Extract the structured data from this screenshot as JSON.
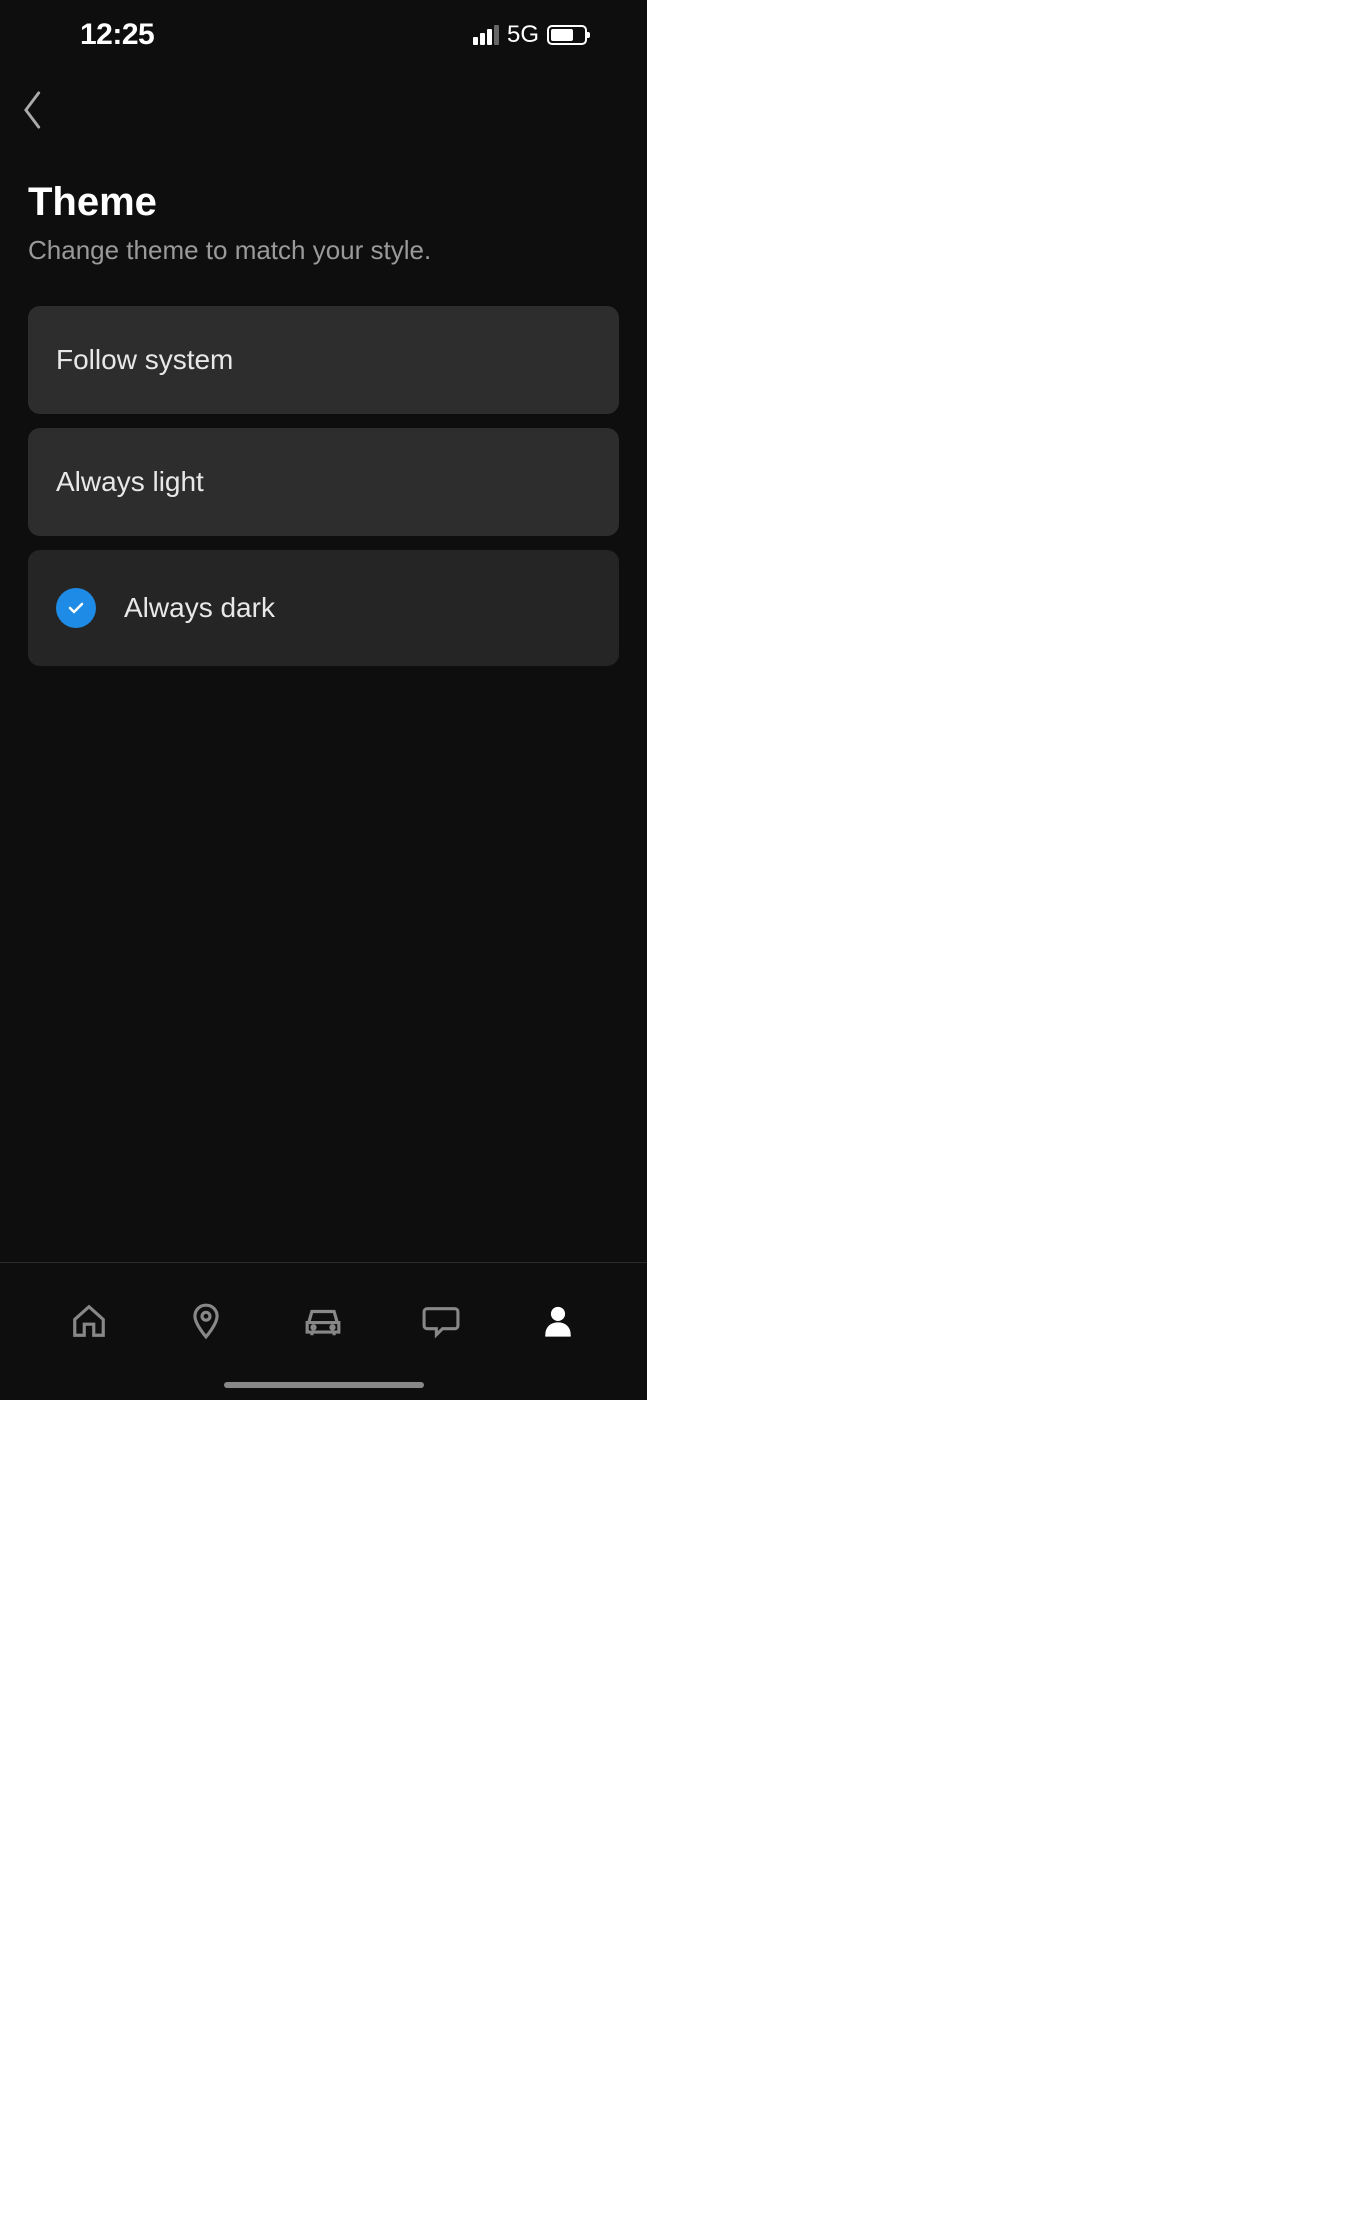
{
  "status_bar": {
    "time": "12:25",
    "network_type": "5G"
  },
  "page": {
    "title": "Theme",
    "subtitle": "Change theme to match your style."
  },
  "options": [
    {
      "label": "Follow system",
      "selected": false
    },
    {
      "label": "Always light",
      "selected": false
    },
    {
      "label": "Always dark",
      "selected": true
    }
  ],
  "bottom_nav": {
    "items": [
      "home",
      "location",
      "car",
      "chat",
      "profile"
    ],
    "active": "profile"
  }
}
